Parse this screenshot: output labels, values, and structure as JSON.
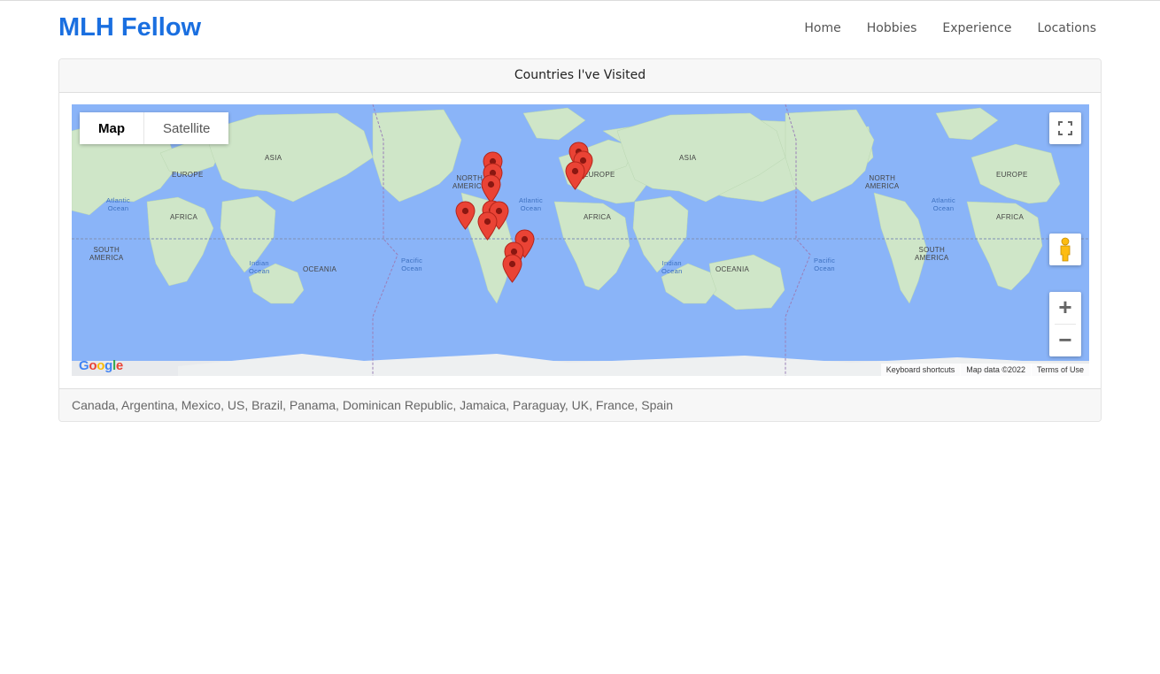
{
  "brand": {
    "title": "MLH Fellow"
  },
  "nav": {
    "items": [
      "Home",
      "Hobbies",
      "Experience",
      "Locations"
    ]
  },
  "card": {
    "header": "Countries I've Visited",
    "footer": "Canada, Argentina, Mexico, US, Brazil, Panama, Dominican Republic, Jamaica, Paraguay, UK, France, Spain"
  },
  "map": {
    "type_buttons": [
      "Map",
      "Satellite"
    ],
    "active_type": "Map",
    "labels": {
      "asia": "ASIA",
      "europe": "EUROPE",
      "africa": "AFRICA",
      "north_america_1": "NORTH",
      "north_america_2": "AMERICA",
      "south_america_1": "SOUTH",
      "south_america_2": "AMERICA",
      "oceania": "OCEANIA",
      "atlantic_1": "Atlantic",
      "atlantic_2": "Ocean",
      "indian_1": "Indian",
      "indian_2": "Ocean",
      "pacific_1": "Pacific",
      "pacific_2": "Ocean"
    },
    "zoom_in": "+",
    "zoom_out": "−",
    "logo": "Google",
    "attribution": [
      "Keyboard shortcuts",
      "Map data ©2022",
      "Terms of Use"
    ],
    "colors": {
      "water": "#8ab4f8",
      "land": "#cfe6c8",
      "marker": "#ea4335"
    },
    "icons": [
      "fullscreen-icon",
      "pegman-icon",
      "map-marker-icon"
    ]
  }
}
